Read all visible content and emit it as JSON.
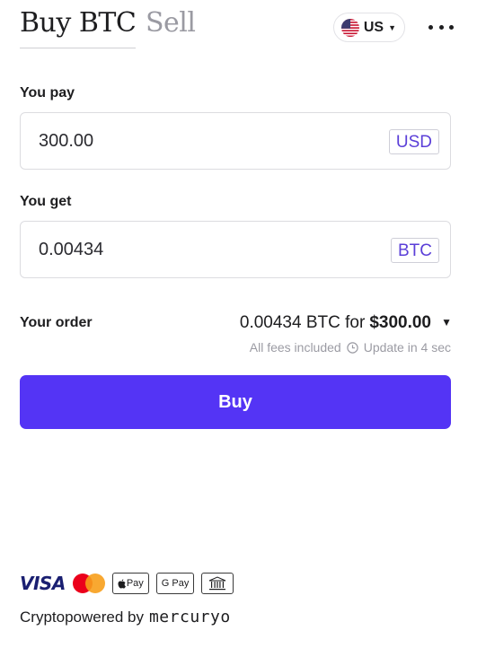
{
  "tabs": {
    "buy_label": "Buy BTC",
    "sell_label": "Sell"
  },
  "country": {
    "label": "US",
    "flag_icon": "us-flag-icon"
  },
  "menu": {
    "icon": "more-dots-icon"
  },
  "pay": {
    "label": "You pay",
    "value": "300.00",
    "currency": "USD"
  },
  "get": {
    "label": "You get",
    "value": "0.00434",
    "currency": "BTC"
  },
  "order": {
    "label": "Your order",
    "amount_text": "0.00434 BTC for",
    "price_text": "$300.00",
    "fees_text": "All fees included",
    "update_text": "Update in 4 sec"
  },
  "buy_button": {
    "label": "Buy"
  },
  "payment_methods": {
    "visa_label": "VISA",
    "apple_pay_label": "Pay",
    "google_pay_label": "G Pay"
  },
  "footer": {
    "powered_text": "Cryptopowered by",
    "brand": "mercuryo"
  },
  "colors": {
    "accent": "#5434f5",
    "currency_text": "#5b3fd8",
    "muted": "#9b9ba3"
  }
}
